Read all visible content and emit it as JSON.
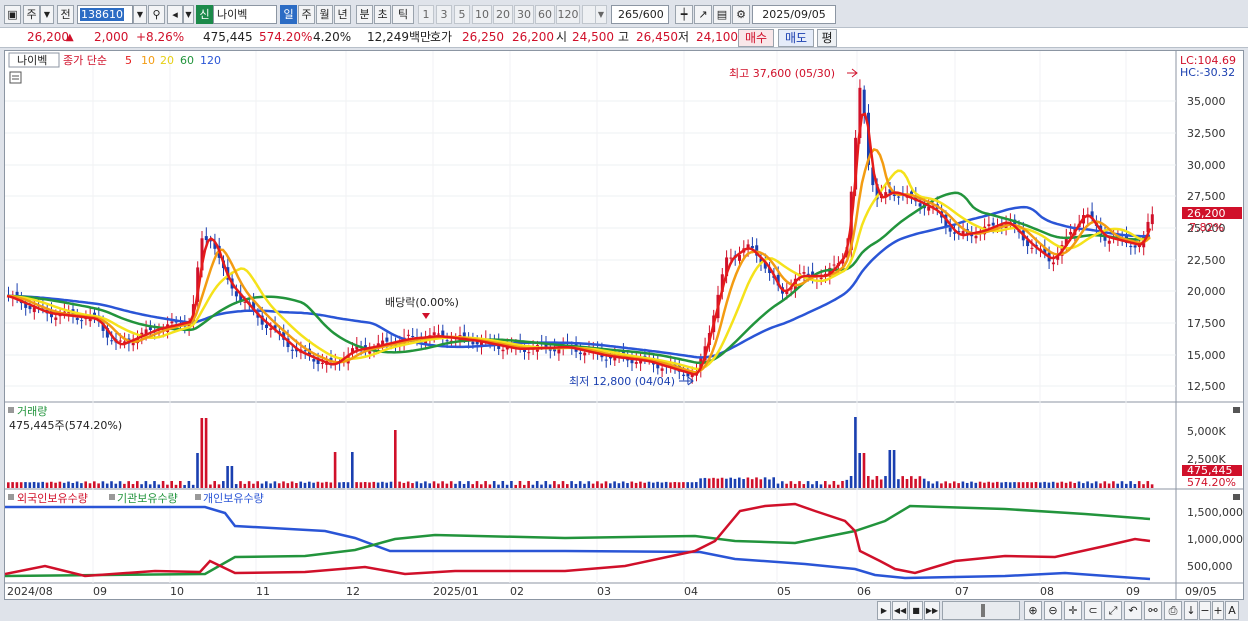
{
  "toolbar": {
    "mode_label": "주",
    "prev_label": "전",
    "code_value": "138610",
    "name_badge": "신",
    "stock_name": "나이벡",
    "periods": [
      "일",
      "주",
      "월",
      "년",
      "분",
      "초",
      "틱"
    ],
    "active_period": "일",
    "intervals": [
      "1",
      "3",
      "5",
      "10",
      "20",
      "30",
      "60",
      "120"
    ],
    "count_value": "265",
    "count_total": "/600",
    "date_value": "2025/09/05"
  },
  "quote": {
    "price": "26,200",
    "change": "2,000",
    "change_pct": "+8.26%",
    "volume": "475,445",
    "volume_ratio": "574.20%",
    "turnover_pct": "4.20%",
    "amount": "12,249백만",
    "ask_label": "호가",
    "ask1": "26,250",
    "ask2": "26,200",
    "open_label": "시",
    "open": "24,500",
    "high_label": "고",
    "high": "26,450",
    "low_label": "저",
    "low": "24,100",
    "buy_label": "매수",
    "sell_label": "매도",
    "eval_label": "평"
  },
  "chart": {
    "name_tag": "나이벡",
    "legend_prefix": "종가 단순",
    "ma_labels": [
      "5",
      "10",
      "20",
      "60",
      "120"
    ],
    "ma_colors": [
      "#e41b1b",
      "#f39c12",
      "#f5e21b",
      "#22943c",
      "#2a55d6"
    ],
    "lc_label": "LC:104.69",
    "hc_label": "HC:-30.32",
    "high_annotation": "최고 37,600 (05/30)",
    "low_annotation": "최저 12,800 (04/04)",
    "dividend_annotation": "배당락(0.00%)",
    "price_badge": "26,200",
    "price_badge_pct": "7.82%",
    "price_axis": [
      "35,000",
      "32,500",
      "30,000",
      "27,500",
      "25,000",
      "22,500",
      "20,000",
      "17,500",
      "15,000",
      "12,500"
    ],
    "volume_title": "거래량",
    "volume_info": "475,445주(574.20%)",
    "volume_axis": [
      "5,000K",
      "2,500K"
    ],
    "volume_badge": "475,445",
    "volume_badge_pct": "574.20%",
    "holding_legend": [
      "외국인보유수량",
      "기관보유수량",
      "개인보유수량"
    ],
    "holding_colors": [
      "#d0102a",
      "#22943c",
      "#2a55d6"
    ],
    "holding_axis": [
      "1,500,000",
      "1,000,000",
      "500,000"
    ],
    "x_labels": [
      "2024/08",
      "09",
      "10",
      "11",
      "12",
      "2025/01",
      "02",
      "03",
      "04",
      "05",
      "06",
      "07",
      "08",
      "09",
      "09/05"
    ]
  }
}
